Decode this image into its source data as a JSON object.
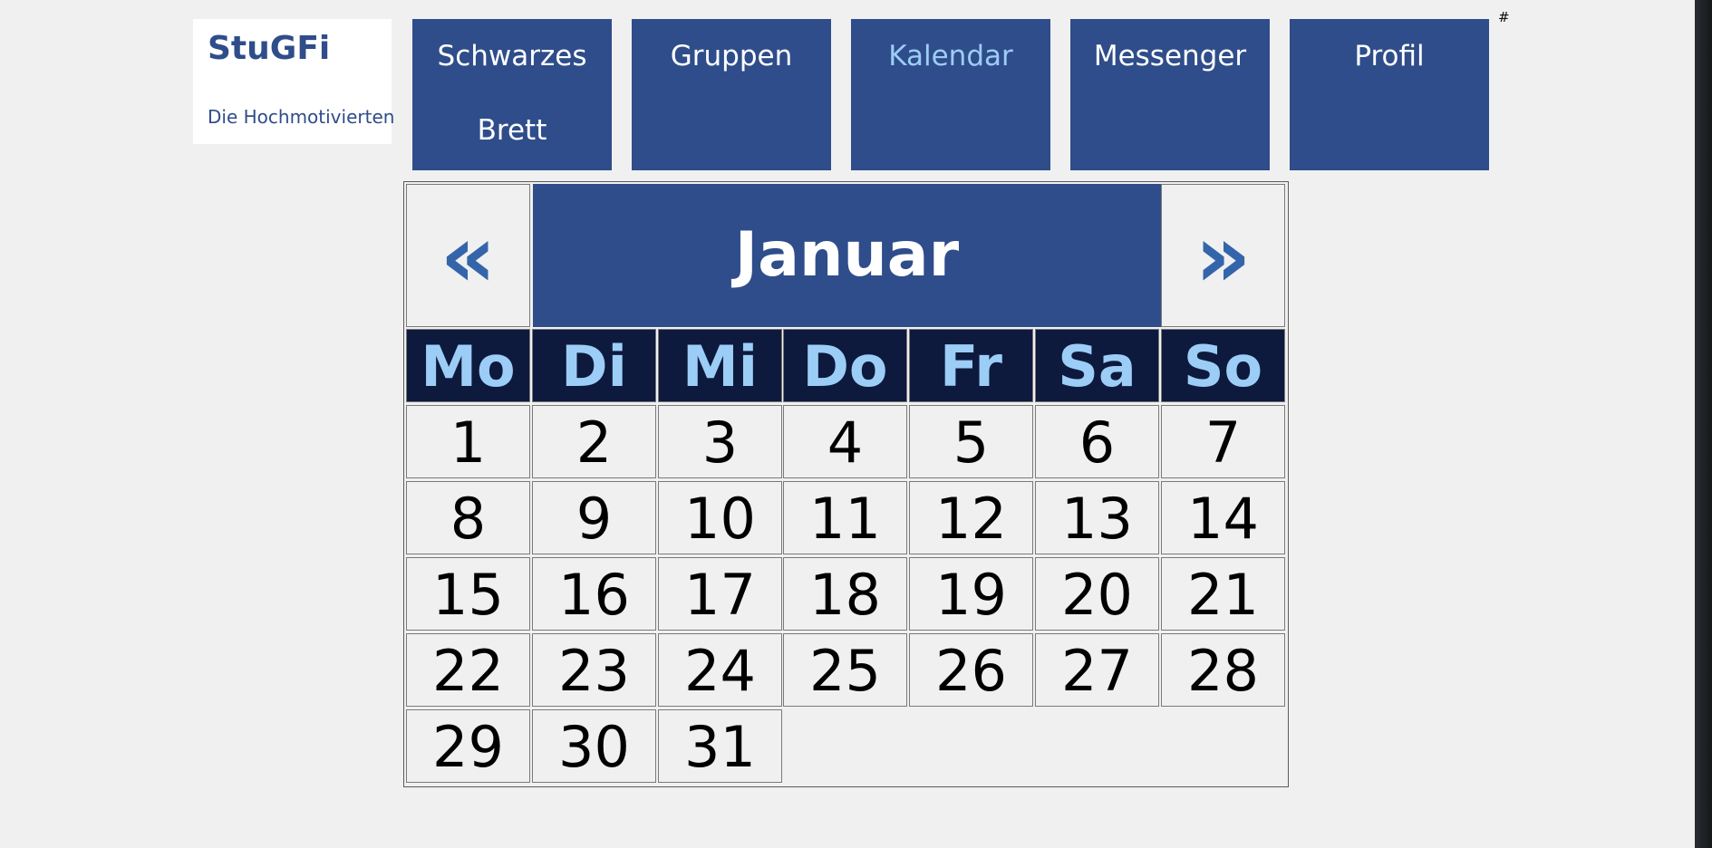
{
  "logo": {
    "title": "StuGFi",
    "subtitle": "Die Hochmotivierten"
  },
  "nav": {
    "items": [
      {
        "line1": "Schwarzes",
        "line2": "Brett"
      },
      {
        "line1": "Gruppen",
        "line2": ""
      },
      {
        "line1": "Kalendar",
        "line2": ""
      },
      {
        "line1": "Messenger",
        "line2": ""
      },
      {
        "line1": "Profil",
        "line2": ""
      }
    ],
    "active_index": 2,
    "active_color": "#9ccdf6",
    "background_color": "#2f4d8a"
  },
  "corner_text": "#",
  "calendar": {
    "prev_symbol": "«",
    "next_symbol": "»",
    "month": "Januar",
    "weekdays": [
      "Mo",
      "Di",
      "Mi",
      "Do",
      "Fr",
      "Sa",
      "So"
    ],
    "dates": [
      "1",
      "2",
      "3",
      "4",
      "5",
      "6",
      "7",
      "8",
      "9",
      "10",
      "11",
      "12",
      "13",
      "14",
      "15",
      "16",
      "17",
      "18",
      "19",
      "20",
      "21",
      "22",
      "23",
      "24",
      "25",
      "26",
      "27",
      "28",
      "29",
      "30",
      "31"
    ]
  }
}
